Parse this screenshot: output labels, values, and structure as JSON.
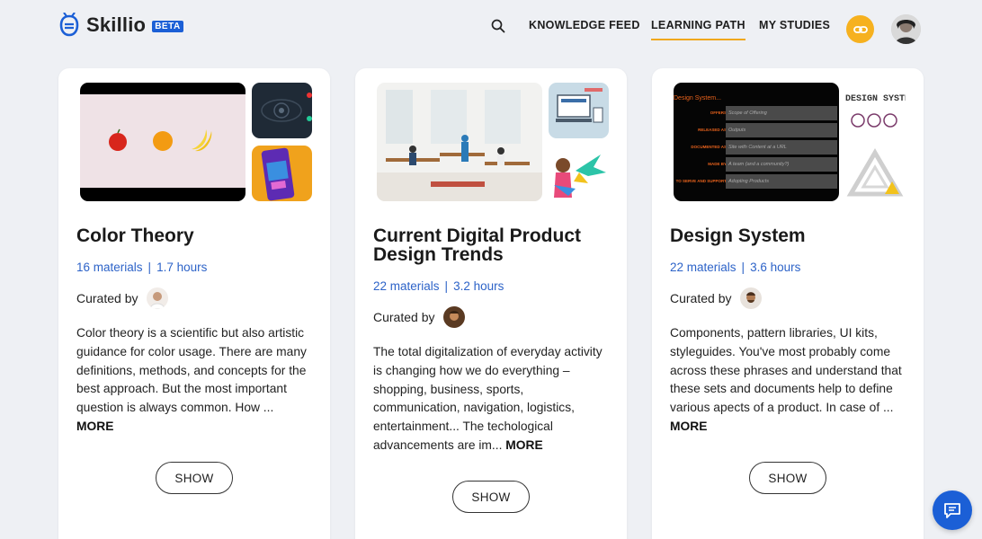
{
  "header": {
    "brand": "Skillio",
    "badge": "BETA",
    "nav": [
      {
        "label": "KNOWLEDGE FEED",
        "active": false
      },
      {
        "label": "LEARNING PATH",
        "active": true
      },
      {
        "label": "MY STUDIES",
        "active": false
      }
    ],
    "icons": {
      "search": "search-icon",
      "link": "link-icon",
      "chat": "chat-icon"
    },
    "accent": "#f6b11f",
    "brand_color": "#1b5fd6"
  },
  "cards": [
    {
      "title": "Color Theory",
      "materials": "16 materials",
      "hours": "1.7 hours",
      "curated_label": "Curated by",
      "description": "Color theory is a scientific but also artistic guidance for color usage. There are many definitions, methods, and concepts for the best approach. But the most important question is always common. How ...",
      "more": "MORE",
      "button": "SHOW"
    },
    {
      "title": "Current Digital Product Design Trends",
      "materials": "22 materials",
      "hours": "3.2 hours",
      "curated_label": "Curated by",
      "description": "The total digitalization of everyday activity is changing how we do everything – shopping, business, sports, communication, navigation, logistics, entertainment... The techological advancements are im...",
      "more": "MORE",
      "button": "SHOW"
    },
    {
      "title": "Design System",
      "materials": "22 materials",
      "hours": "3.6 hours",
      "curated_label": "Curated by",
      "description": "Components, pattern libraries, UI kits, styleguides. You've most probably come across these phrases and understand that these sets and documents help to define various apects of a product. In case of ...",
      "more": "MORE",
      "button": "SHOW",
      "thumb": {
        "title": "Design System...",
        "rows": [
          {
            "label": "OFFERS",
            "value": "Scope of Offering"
          },
          {
            "label": "RELEASED AS",
            "value": "Outputs"
          },
          {
            "label": "DOCUMENTED AS",
            "value": "Site with Content at a URL"
          },
          {
            "label": "MADE BY",
            "value": "A team (and a community?)"
          },
          {
            "label": "TO SERVE AND SUPPORT",
            "value": "Adopting Products"
          }
        ],
        "side_text": "DESIGN SYSTE"
      }
    }
  ]
}
